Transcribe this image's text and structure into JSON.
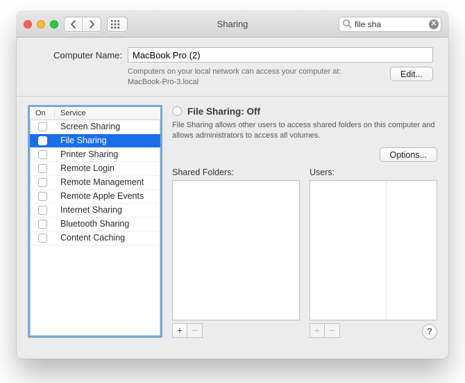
{
  "window": {
    "title": "Sharing"
  },
  "search": {
    "value": "file sha",
    "placeholder": "Search"
  },
  "computerName": {
    "label": "Computer Name:",
    "value": "MacBook Pro (2)",
    "hint": "Computers on your local network can access your computer at:",
    "hostname": "MacBook-Pro-3.local",
    "editLabel": "Edit..."
  },
  "servicesHeader": {
    "on": "On",
    "service": "Service"
  },
  "services": [
    {
      "name": "Screen Sharing",
      "on": false,
      "selected": false
    },
    {
      "name": "File Sharing",
      "on": false,
      "selected": true
    },
    {
      "name": "Printer Sharing",
      "on": false,
      "selected": false
    },
    {
      "name": "Remote Login",
      "on": false,
      "selected": false
    },
    {
      "name": "Remote Management",
      "on": false,
      "selected": false
    },
    {
      "name": "Remote Apple Events",
      "on": false,
      "selected": false
    },
    {
      "name": "Internet Sharing",
      "on": false,
      "selected": false
    },
    {
      "name": "Bluetooth Sharing",
      "on": false,
      "selected": false
    },
    {
      "name": "Content Caching",
      "on": false,
      "selected": false
    }
  ],
  "detail": {
    "statusTitle": "File Sharing: Off",
    "description": "File Sharing allows other users to access shared folders on this computer and allows administrators to access all volumes.",
    "optionsLabel": "Options...",
    "sharedFoldersLabel": "Shared Folders:",
    "usersLabel": "Users:"
  },
  "icons": {
    "plus": "+",
    "minus": "−",
    "help": "?"
  }
}
